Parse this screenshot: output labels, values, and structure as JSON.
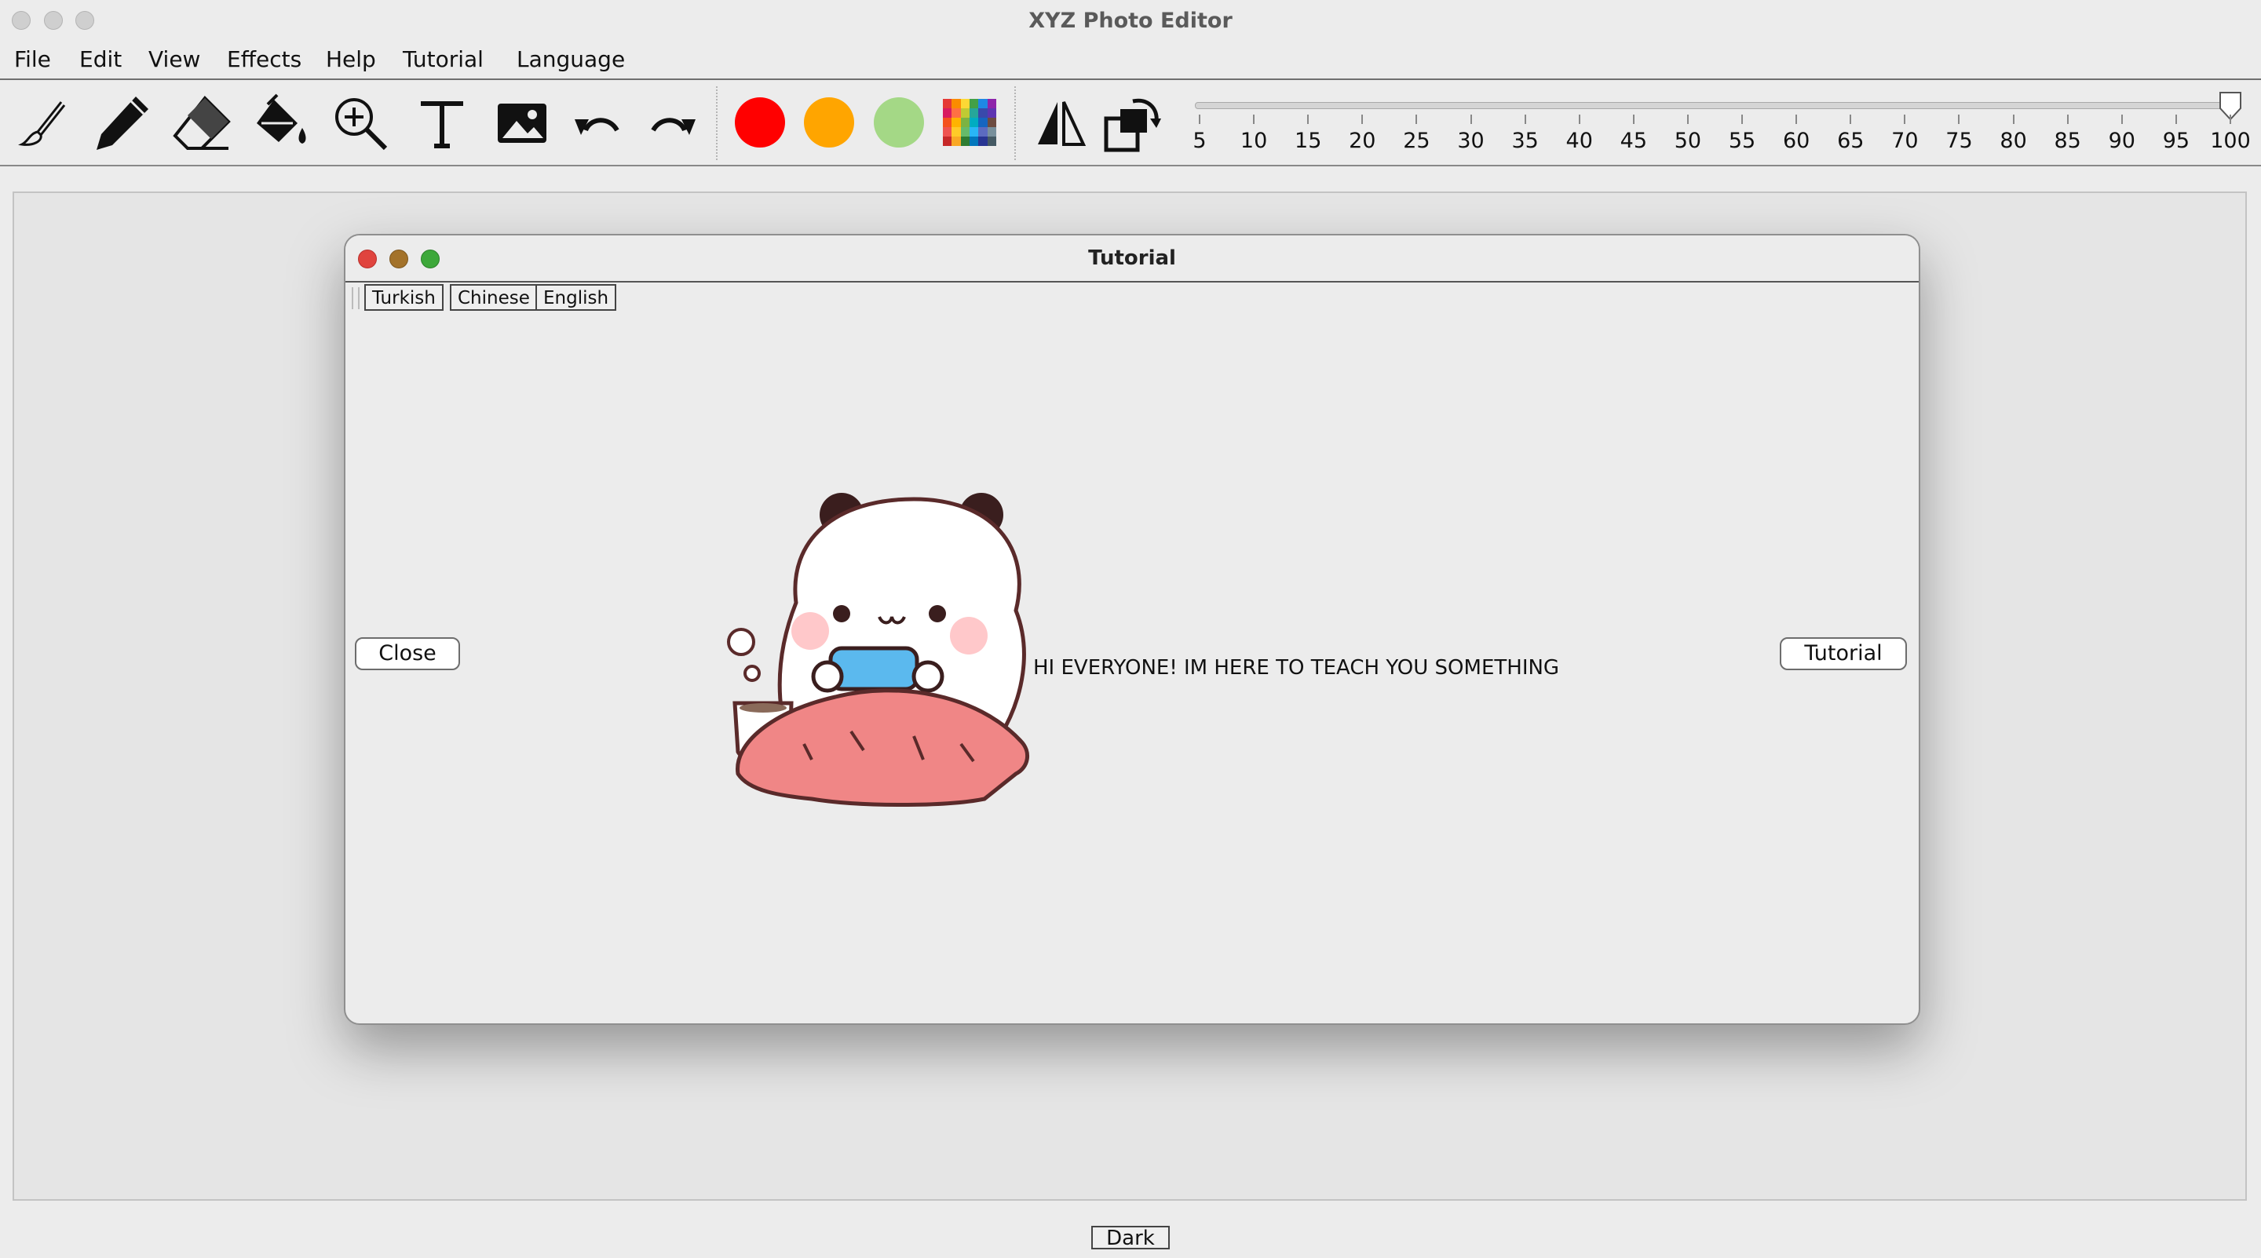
{
  "window": {
    "title": "XYZ Photo Editor"
  },
  "menu": [
    "File",
    "Edit",
    "View",
    "Effects",
    "Help",
    "Tutorial",
    "Language"
  ],
  "toolbar": {
    "tools": [
      "brush-icon",
      "pencil-icon",
      "eraser-icon",
      "paint-bucket-icon",
      "zoom-in-icon",
      "text-icon",
      "image-icon",
      "undo-icon",
      "redo-icon"
    ],
    "colors": [
      "#ff0000",
      "#ffa500",
      "#a4d886"
    ],
    "extra_tools": [
      "flip-horizontal-icon",
      "rotate-icon"
    ],
    "size_slider": {
      "value": 100,
      "tick_labels": [
        "5",
        "10",
        "15",
        "20",
        "25",
        "30",
        "35",
        "40",
        "45",
        "50",
        "55",
        "60",
        "65",
        "70",
        "75",
        "80",
        "85",
        "90",
        "95",
        "100"
      ]
    }
  },
  "dialog": {
    "title": "Tutorial",
    "languages": [
      "Turkish",
      "Chinese",
      "English"
    ],
    "close_label": "Close",
    "tutorial_label": "Tutorial",
    "message": "HI EVERYONE! IM HERE TO TEACH YOU SOMETHING",
    "image": "panda-mascot-illustration"
  },
  "footer": {
    "dark_label": "Dark"
  }
}
